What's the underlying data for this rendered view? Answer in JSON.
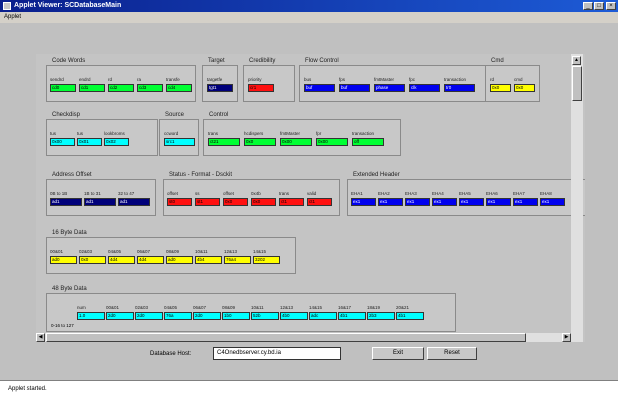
{
  "window": {
    "title": "Applet Viewer: SCDatabaseMain",
    "minimize": "_",
    "maximize": "□",
    "close": "×"
  },
  "menu": {
    "applet": "Applet"
  },
  "groups": [
    {
      "title": "Code Words",
      "fields": [
        {
          "label": "sendrd",
          "value": "cd0",
          "color": "g"
        },
        {
          "label": "endrd",
          "value": "cd1",
          "color": "g"
        },
        {
          "label": "rd",
          "value": "cd2",
          "color": "g"
        },
        {
          "label": "ra",
          "value": "cd3",
          "color": "g"
        },
        {
          "label": "transfe",
          "value": "cd4",
          "color": "g"
        }
      ]
    },
    {
      "title": "Target",
      "fields": [
        {
          "label": "targetfe",
          "value": "tgt1",
          "color": "nv"
        }
      ]
    },
    {
      "title": "Credibility",
      "fields": [
        {
          "label": "priority",
          "value": "cr1",
          "color": "r"
        }
      ]
    },
    {
      "title": "Flow Control",
      "fields": [
        {
          "label": "bus",
          "value": "buf",
          "color": "b"
        },
        {
          "label": "fps",
          "value": "buf",
          "color": "b"
        },
        {
          "label": "fmtMaster",
          "value": "phase",
          "color": "b"
        },
        {
          "label": "fpc",
          "value": "clk",
          "color": "b"
        },
        {
          "label": "transaction",
          "value": "tr0",
          "color": "b"
        }
      ]
    },
    {
      "title": "Cmd",
      "fields": [
        {
          "label": "rd",
          "value": "0x0",
          "color": "y"
        },
        {
          "label": "cmd",
          "value": "0x0",
          "color": "y"
        }
      ]
    },
    {
      "title": "Checkdisp",
      "fields": [
        {
          "label": "tus",
          "value": "0x00",
          "color": "c"
        },
        {
          "label": "tus",
          "value": "0x01",
          "color": "c"
        },
        {
          "label": "lookbroms",
          "value": "0x02",
          "color": "c"
        }
      ]
    },
    {
      "title": "Source",
      "fields": [
        {
          "label": "ccword",
          "value": "src1",
          "color": "c"
        }
      ]
    },
    {
      "title": "Control",
      "fields": [
        {
          "label": "trans",
          "value": "ct21",
          "color": "g"
        },
        {
          "label": "hcdispers",
          "value": "0x0",
          "color": "g"
        },
        {
          "label": "fmtMaster",
          "value": "0x00",
          "color": "g"
        },
        {
          "label": "fpr",
          "value": "0x00",
          "color": "g"
        },
        {
          "label": "transaction",
          "value": "off",
          "color": "g"
        }
      ]
    },
    {
      "title": "Address Offset",
      "fields": [
        {
          "label": "0B to 1B",
          "value": "ad1",
          "color": "nv"
        },
        {
          "label": "1B to 31",
          "value": "ad1",
          "color": "nv"
        },
        {
          "label": "32 to 47",
          "value": "ad1",
          "color": "nv"
        }
      ]
    },
    {
      "title": "Status - Format - Dsckit",
      "fields": [
        {
          "label": "offset",
          "value": "st0",
          "color": "r"
        },
        {
          "label": "ss",
          "value": "st1",
          "color": "r"
        },
        {
          "label": "offset",
          "value": "0x0",
          "color": "r"
        },
        {
          "label": "0x4b",
          "value": "0x0",
          "color": "r"
        },
        {
          "label": "trans",
          "value": "ct1",
          "color": "r"
        },
        {
          "label": "valid",
          "value": "ct1",
          "color": "r"
        }
      ]
    },
    {
      "title": "Extended Header",
      "fields": [
        {
          "label": "EHA1",
          "value": "ex1",
          "color": "b"
        },
        {
          "label": "EHA2",
          "value": "ex1",
          "color": "b"
        },
        {
          "label": "EHA3",
          "value": "ex1",
          "color": "b"
        },
        {
          "label": "EHA4",
          "value": "ex1",
          "color": "b"
        },
        {
          "label": "EHA5",
          "value": "ex1",
          "color": "b"
        },
        {
          "label": "EHA6",
          "value": "ex1",
          "color": "b"
        },
        {
          "label": "EHA7",
          "value": "ex1",
          "color": "b"
        },
        {
          "label": "EHA8",
          "value": "ex1",
          "color": "b"
        }
      ]
    },
    {
      "title": "16 Byte Data",
      "fields": [
        {
          "label": "00&01",
          "value": "ad0",
          "color": "y"
        },
        {
          "label": "02&03",
          "value": "0x0",
          "color": "y"
        },
        {
          "label": "04&05",
          "value": "4d4",
          "color": "y"
        },
        {
          "label": "06&07",
          "value": "4d4",
          "color": "y"
        },
        {
          "label": "08&09",
          "value": "ad0",
          "color": "y"
        },
        {
          "label": "10&11",
          "value": "4b4",
          "color": "y"
        },
        {
          "label": "12&13",
          "value": "76a4",
          "color": "y"
        },
        {
          "label": "14&15",
          "value": "3202",
          "color": "y"
        }
      ]
    },
    {
      "title": "48 Byte Data",
      "rowlabel": "0-16 to 127",
      "fields": [
        {
          "label": "num",
          "value": "1.0",
          "color": "c"
        },
        {
          "label": "00&01",
          "value": "2d0",
          "color": "c"
        },
        {
          "label": "02&03",
          "value": "2d0",
          "color": "c"
        },
        {
          "label": "04&05",
          "value": "76a",
          "color": "c"
        },
        {
          "label": "06&07",
          "value": "2d0",
          "color": "c"
        },
        {
          "label": "08&09",
          "value": "1b0",
          "color": "c"
        },
        {
          "label": "10&11",
          "value": "52b",
          "color": "c"
        },
        {
          "label": "12&13",
          "value": "4b0",
          "color": "c"
        },
        {
          "label": "14&15",
          "value": "adc",
          "color": "c"
        },
        {
          "label": "16&17",
          "value": "4b1",
          "color": "c"
        },
        {
          "label": "18&19",
          "value": "2b3",
          "color": "c"
        },
        {
          "label": "20&21",
          "value": "4b1",
          "color": "c"
        }
      ]
    }
  ],
  "footer": {
    "host_label": "Database Host:",
    "host_value": "C4Onedbserver.cy.bd.ia",
    "exit": "Exit",
    "reset": "Reset"
  },
  "status": "Applet started."
}
